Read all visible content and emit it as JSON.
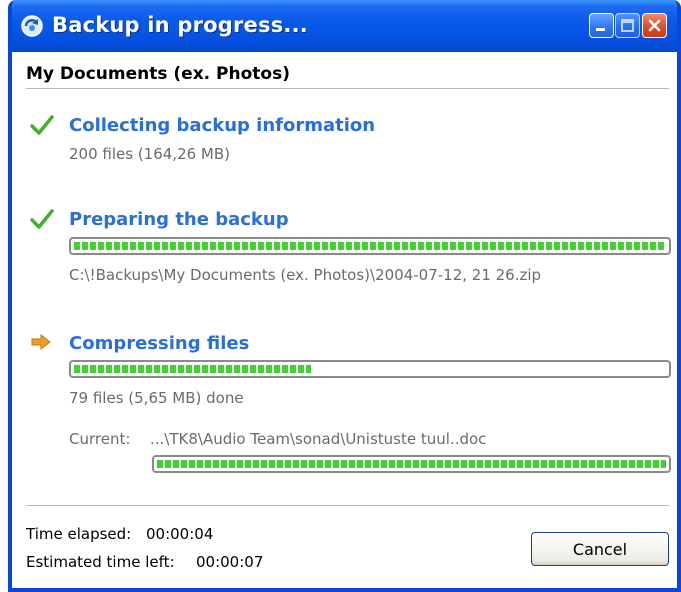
{
  "window": {
    "title": "Backup in progress...",
    "icon": "backup-app-icon",
    "controls": [
      "minimize-icon",
      "maximize-icon",
      "close-icon"
    ]
  },
  "section_title": "My Documents (ex. Photos)",
  "steps": [
    {
      "status": "done",
      "icon": "checkmark-icon",
      "title": "Collecting backup information",
      "detail": "200 files (164,26 MB)"
    },
    {
      "status": "done",
      "icon": "checkmark-icon",
      "title": "Preparing the backup",
      "progress": 1.0,
      "detail": "C:\\!Backups\\My Documents (ex. Photos)\\2004-07-12, 21 26.zip"
    },
    {
      "status": "in-progress",
      "icon": "arrow-right-icon",
      "title": "Compressing files",
      "progress": 0.4,
      "detail": "79 files (5,65 MB) done",
      "current_label": "Current:",
      "current_file": "...\\TK8\\Audio Team\\sonad\\Unistuste tuul..doc",
      "current_progress": 1.0
    }
  ],
  "footer": {
    "elapsed_label": "Time elapsed:",
    "elapsed_value": "00:00:04",
    "left_label": "Estimated time left:",
    "left_value": "00:00:07",
    "cancel_label": "Cancel"
  },
  "colors": {
    "title_bar": "#0a5ae8",
    "step_title": "#2a6ed9",
    "progress_fill": "#3fd12d",
    "check": "#3fb12a",
    "arrow": "#f0a020"
  }
}
